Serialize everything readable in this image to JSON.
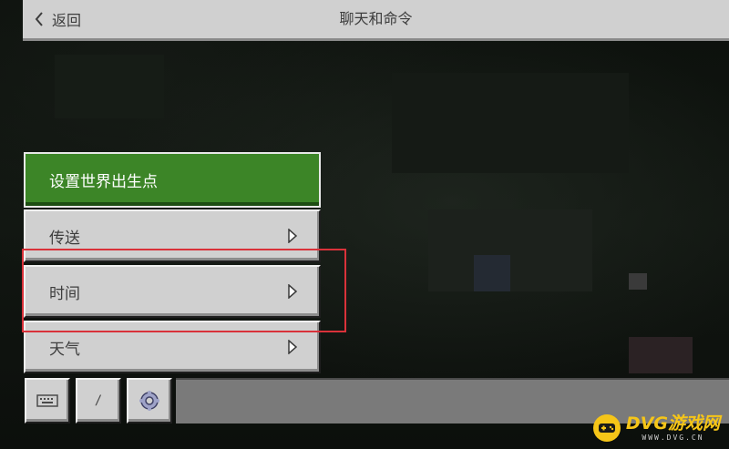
{
  "header": {
    "back_label": "返回",
    "title": "聊天和命令"
  },
  "menu": {
    "items": [
      {
        "label": "设置世界出生点",
        "style": "primary",
        "has_arrow": false
      },
      {
        "label": "传送",
        "style": "default",
        "has_arrow": true
      },
      {
        "label": "时间",
        "style": "default",
        "has_arrow": true
      },
      {
        "label": "天气",
        "style": "default",
        "has_arrow": true
      }
    ]
  },
  "bottom": {
    "keyboard_icon": "keyboard-icon",
    "slash_label": "/",
    "settings_icon": "gear-icon",
    "chat_input_value": ""
  },
  "watermark": {
    "main": "DVG游戏网",
    "sub": "WWW.DVG.CN"
  },
  "colors": {
    "primary": "#3c8527",
    "button": "#d0d0d0",
    "highlight": "#d9323a",
    "watermark": "#f5c518"
  }
}
